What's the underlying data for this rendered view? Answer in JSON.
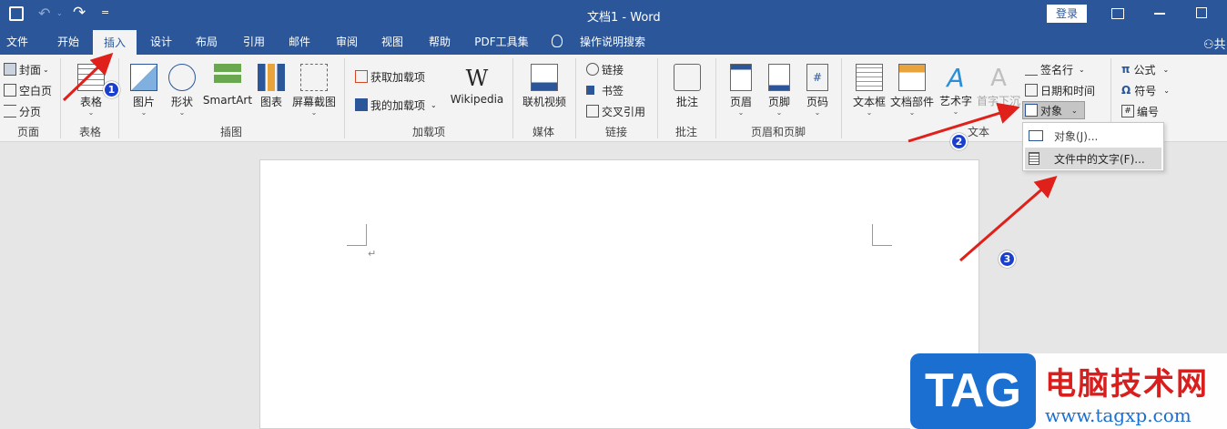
{
  "titlebar": {
    "doc_title": "文档1  -  Word",
    "login": "登录",
    "qat_more": "="
  },
  "tabs": [
    "文件",
    "开始",
    "插入",
    "设计",
    "布局",
    "引用",
    "邮件",
    "审阅",
    "视图",
    "帮助",
    "PDF工具集",
    "操作说明搜索"
  ],
  "share_partial": "共",
  "ribbon": {
    "pages": {
      "cover": "封面",
      "blank": "空白页",
      "break": "分页",
      "group": "页面"
    },
    "tables": {
      "table": "表格",
      "group": "表格"
    },
    "illustrations": {
      "pictures": "图片",
      "shapes": "形状",
      "smartart": "SmartArt",
      "chart": "图表",
      "screenshot": "屏幕截图",
      "group": "插图"
    },
    "addins": {
      "get": "获取加载项",
      "my": "我的加载项",
      "wiki_logo": "W",
      "wiki": "Wikipedia",
      "group": "加载项"
    },
    "media": {
      "video": "联机视频",
      "group": "媒体"
    },
    "links": {
      "link": "链接",
      "bookmark": "书签",
      "crossref": "交叉引用",
      "group": "链接"
    },
    "comments": {
      "comment": "批注",
      "group": "批注"
    },
    "headerfooter": {
      "header": "页眉",
      "footer": "页脚",
      "pagenum": "页码",
      "pagenum_glyph": "#",
      "group": "页眉和页脚"
    },
    "text": {
      "textbox": "文本框",
      "quickparts": "文档部件",
      "wordart": "艺术字",
      "wordart_glyph": "A",
      "dropcap": "首字下沉",
      "dropcap_glyph": "A",
      "sigline": "签名行",
      "datetime": "日期和时间",
      "object": "对象",
      "group": "文本"
    },
    "symbols": {
      "equation": "公式",
      "symbol": "符号",
      "number": "编号",
      "pi": "π",
      "omega": "Ω",
      "numglyph": "#"
    }
  },
  "dropdown": {
    "object_item": "对象(J)...",
    "text_from_file": "文件中的文字(F)..."
  },
  "badges": [
    "1",
    "2",
    "3"
  ],
  "watermark": {
    "logo": "TAG",
    "title": "电脑技术网",
    "url": "www.tagxp.com"
  },
  "doc": {
    "para_mark": "↵"
  }
}
